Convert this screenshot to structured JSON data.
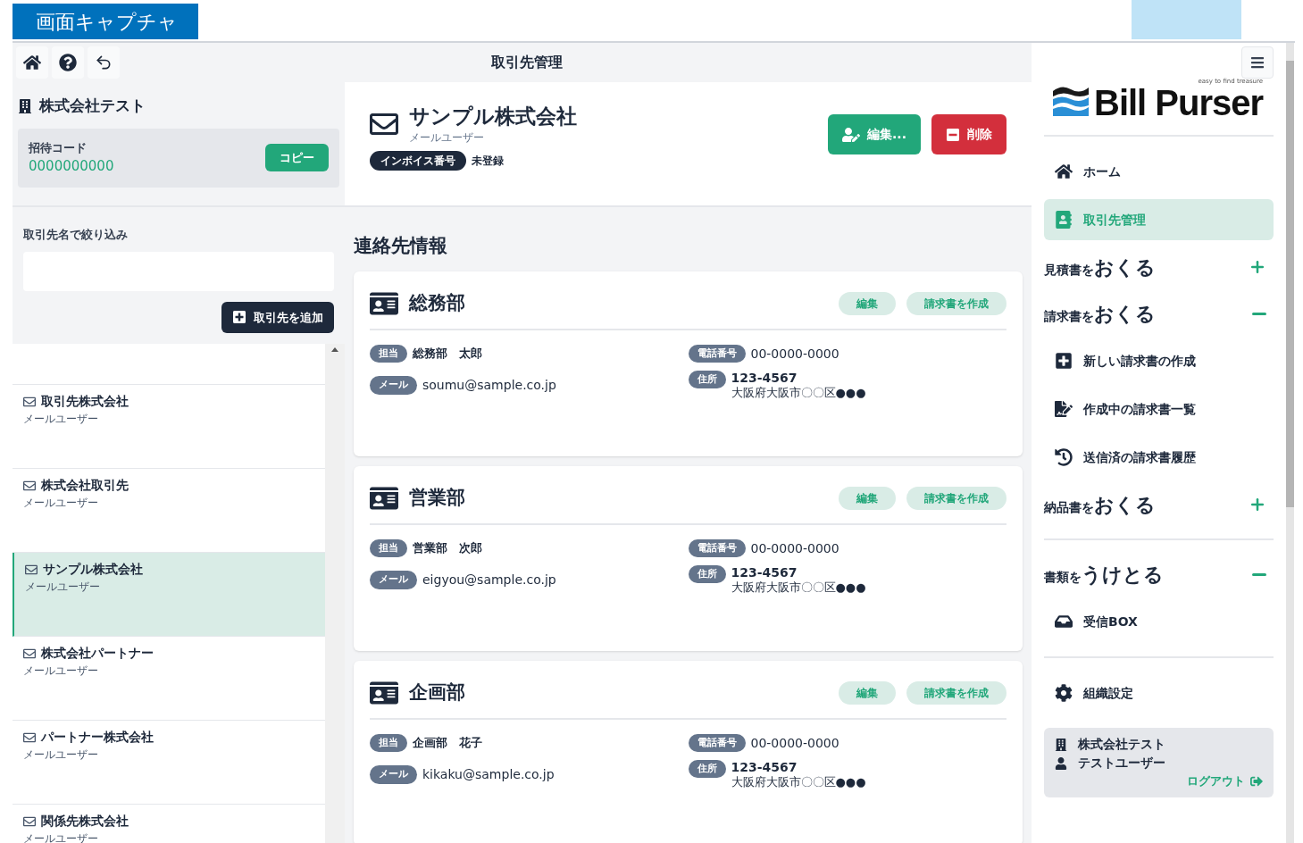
{
  "banner": {
    "label": "画面キャプチャ"
  },
  "toolbar": {
    "title": "取引先管理"
  },
  "org": {
    "name": "株式会社テスト",
    "invite_label": "招待コード",
    "invite_code": "0000000000",
    "copy_button": "コピー"
  },
  "filter": {
    "label": "取引先名で絞り込み"
  },
  "add_button": "取引先を追加",
  "partners": [
    {
      "name": "取引先株式会社",
      "subtitle": "メールユーザー",
      "selected": false
    },
    {
      "name": "株式会社取引先",
      "subtitle": "メールユーザー",
      "selected": false
    },
    {
      "name": "サンプル株式会社",
      "subtitle": "メールユーザー",
      "selected": true
    },
    {
      "name": "株式会社パートナー",
      "subtitle": "メールユーザー",
      "selected": false
    },
    {
      "name": "パートナー株式会社",
      "subtitle": "メールユーザー",
      "selected": false
    },
    {
      "name": "関係先株式会社",
      "subtitle": "メールユーザー",
      "selected": false
    }
  ],
  "detail": {
    "name": "サンプル株式会社",
    "subtitle": "メールユーザー",
    "invoice_badge": "インボイス番号",
    "invoice_status": "未登録",
    "edit_button": "編集...",
    "delete_button": "削除"
  },
  "contacts_heading": "連絡先情報",
  "contacts": [
    {
      "department": "総務部",
      "edit_button": "編集",
      "invoice_button": "請求書を作成",
      "person_label": "担当",
      "person": "総務部　太郎",
      "email_label": "メール",
      "email": "soumu@sample.co.jp",
      "phone_label": "電話番号",
      "phone": "00-0000-0000",
      "address_label": "住所",
      "postal": "123-4567",
      "address": "大阪府大阪市〇〇区●●●"
    },
    {
      "department": "営業部",
      "edit_button": "編集",
      "invoice_button": "請求書を作成",
      "person_label": "担当",
      "person": "営業部　次郎",
      "email_label": "メール",
      "email": "eigyou@sample.co.jp",
      "phone_label": "電話番号",
      "phone": "00-0000-0000",
      "address_label": "住所",
      "postal": "123-4567",
      "address": "大阪府大阪市〇〇区●●●"
    },
    {
      "department": "企画部",
      "edit_button": "編集",
      "invoice_button": "請求書を作成",
      "person_label": "担当",
      "person": "企画部　花子",
      "email_label": "メール",
      "email": "kikaku@sample.co.jp",
      "phone_label": "電話番号",
      "phone": "00-0000-0000",
      "address_label": "住所",
      "postal": "123-4567",
      "address": "大阪府大阪市〇〇区●●●"
    }
  ],
  "sidebar": {
    "logo": "Bill Purser",
    "tagline": "easy to find treasure",
    "groups": [
      [
        {
          "kind": "nav",
          "label": "ホーム",
          "selected": false
        },
        {
          "kind": "nav",
          "label": "取引先管理",
          "selected": true
        },
        {
          "kind": "section",
          "prefix": "見積書を",
          "label": "おくる",
          "expanded": false
        },
        {
          "kind": "section",
          "prefix": "請求書を",
          "label": "おくる",
          "expanded": true
        },
        {
          "kind": "sub",
          "label": "新しい請求書の作成"
        },
        {
          "kind": "sub",
          "label": "作成中の請求書一覧"
        },
        {
          "kind": "sub",
          "label": "送信済の請求書履歴"
        },
        {
          "kind": "section",
          "prefix": "納品書を",
          "label": "おくる",
          "expanded": false
        }
      ],
      [
        {
          "kind": "section",
          "prefix": "書類を",
          "label": "うけとる",
          "expanded": true
        },
        {
          "kind": "sub",
          "label": "受信BOX"
        }
      ],
      [
        {
          "kind": "nav",
          "label": "組織設定",
          "selected": false
        }
      ]
    ],
    "user_card": {
      "org": "株式会社テスト",
      "user": "テストユーザー",
      "logout": "ログアウト"
    }
  }
}
